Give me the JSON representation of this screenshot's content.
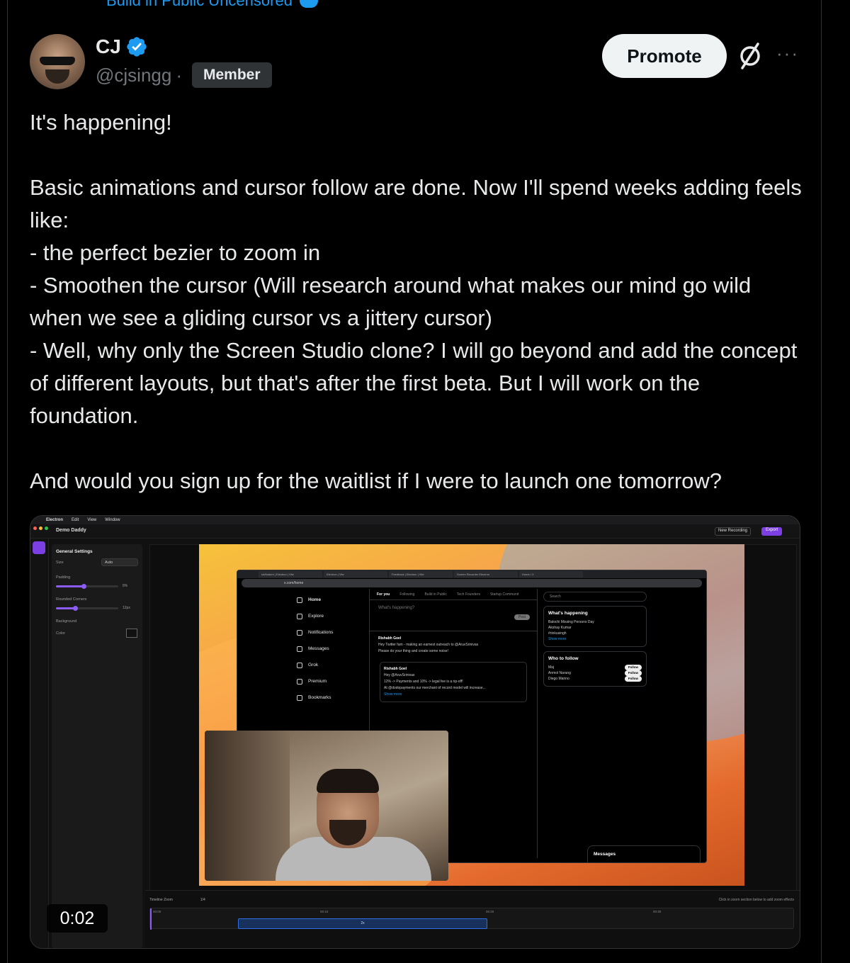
{
  "community": {
    "label": "Build in Public Uncensored"
  },
  "author": {
    "name": "CJ",
    "handle": "@cjsingg",
    "separator": "·",
    "badge": "Member"
  },
  "actions": {
    "promote_label": "Promote",
    "more_label": "···"
  },
  "tweet": {
    "text": "It's happening!\n\nBasic animations and cursor follow are done. Now I'll spend weeks adding feels like:\n- the perfect bezier to zoom in\n- Smoothen the cursor (Will research around what makes our mind go wild when we see a gliding cursor vs a jittery cursor)\n- Well, why only the Screen Studio clone? I will go beyond and add the concept of different layouts, but that's after the first beta. But I will work on the foundation.\n\nAnd would you sign up for the waitlist if I were to launch one tomorrow?"
  },
  "video": {
    "elapsed": "0:02"
  },
  "app": {
    "menu": [
      "Electron",
      "Edit",
      "View",
      "Window"
    ],
    "title": "Demo Daddy",
    "new_recording": "New Recording",
    "export": "Export",
    "settings": {
      "title": "General Settings",
      "size_label": "Size",
      "size_value": "Auto",
      "padding_label": "Padding",
      "padding_value": "8%",
      "corners_label": "Rounded Corners",
      "corners_value": "12px",
      "background_label": "Background",
      "color_label": "Color"
    },
    "timeline": {
      "zoom_label": "Timeline Zoom",
      "zoom_value": "1/4",
      "hint": "Click in zoom section below to add zoom effects",
      "markers": [
        "00:00",
        "00:10",
        "00:20",
        "00:30"
      ],
      "clip_label": "2x"
    }
  },
  "screen": {
    "url": "x.com/home",
    "tabs": [
      "sd/feature | Electron | Vite",
      "Electron | Vite",
      "Feedback | Electron | Vite",
      "Screen Recorder Electron",
      "Home / X"
    ],
    "nav": [
      "Home",
      "Explore",
      "Notifications",
      "Messages",
      "Grok",
      "Premium",
      "Bookmarks"
    ],
    "feed_tabs": [
      "For you",
      "Following",
      "Build in Public",
      "Tech Founders",
      "Startup Communit"
    ],
    "compose_placeholder": "What's happening?",
    "post_label": "Post",
    "tweet_author": "Rishabh Goel",
    "tweet_text": "Hey Twitter fam - making an earnest outreach to @AruvSrinivas",
    "tweet_sub": "Please do your thing and create some noise!",
    "quote_author": "Rishabh Goel",
    "quote_lines": [
      "Hey @AruvSrinivas",
      "12% -> Payments and 10% -> legal fee is a rip-off!",
      "At @dodopayments our merchant of record model will increase...",
      "Show more"
    ],
    "search_placeholder": "Search",
    "happening_title": "What's happening",
    "trends": [
      "Balochi Missing Persons Day",
      "Akshay Kumar",
      "#rinkusingh"
    ],
    "show_more": "Show more",
    "follow_title": "Who to follow",
    "follow_people": [
      "Maj",
      "Anmol Narang",
      "Diego Marino"
    ],
    "follow_label": "Follow",
    "messages_label": "Messages"
  },
  "colors": {
    "accent": "#1d9bf0",
    "app_accent": "#7b3fe4",
    "promote_bg": "#eff3f4"
  }
}
